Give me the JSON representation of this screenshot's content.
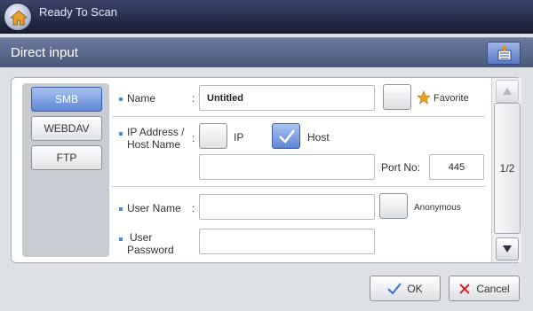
{
  "status_bar": {
    "title": "Ready To Scan",
    "home_icon": "home-icon"
  },
  "header": {
    "title": "Direct input",
    "action_icon": "address-book-icon"
  },
  "tabs": [
    {
      "label": "SMB",
      "active": true
    },
    {
      "label": "WEBDAV",
      "active": false
    },
    {
      "label": "FTP",
      "active": false
    }
  ],
  "form": {
    "name": {
      "label": "Name",
      "colon": ":",
      "value": "Untitled",
      "favorite_label": "Favorite"
    },
    "address": {
      "label_line1": "IP Address /",
      "label_line2": "Host Name",
      "colon": ":",
      "ip_label": "IP",
      "host_label": "Host",
      "host_checked": true,
      "host_value": "",
      "port_label": "Port No:",
      "port_value": "445"
    },
    "user_name": {
      "label": "User Name",
      "colon": ":",
      "value": "",
      "anonymous_label": "Anonymous"
    },
    "user_password": {
      "label_line1": "User",
      "label_line2": "Password",
      "value": ""
    }
  },
  "scroll": {
    "page_indicator": "1/2",
    "up_icon": "triangle-up-icon",
    "down_icon": "triangle-down-icon"
  },
  "buttons": {
    "ok_label": "OK",
    "cancel_label": "Cancel"
  },
  "colors": {
    "accent": "#5f86d6",
    "bullet": "#4c8cd6",
    "cancel_x": "#d9232b",
    "ok_check": "#3e6fc9"
  }
}
